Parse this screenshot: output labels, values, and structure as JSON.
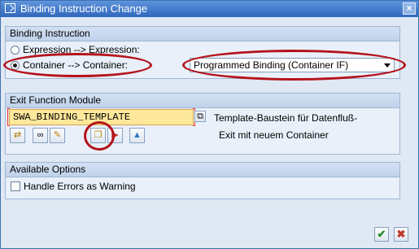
{
  "window": {
    "title": "Binding Instruction Change",
    "close_glyph": "×"
  },
  "binding_instruction": {
    "heading": "Binding Instruction",
    "options": [
      {
        "label": "Expression --> Expression:",
        "selected": false
      },
      {
        "label": "Container --> Container:",
        "selected": true
      }
    ],
    "binding_type": "Programmed Binding (Container IF)"
  },
  "exit_function_module": {
    "heading": "Exit Function Module",
    "value": "SWA_BINDING_TEMPLATE",
    "description_line1": "Template-Baustein für Datenfluß-",
    "description_line2": "Exit mit neuem Container",
    "tools": [
      "change-icon",
      "glasses-icon",
      "pencil-icon",
      "copy-icon",
      "delete-icon",
      "image-icon"
    ]
  },
  "available_options": {
    "heading": "Available Options",
    "checkbox_label": "Handle Errors as Warning",
    "checked": false
  },
  "footer": {
    "ok_glyph": "✔",
    "cancel_glyph": "✖"
  },
  "colors": {
    "annotation": "#b5121b",
    "title_bar": "#2f67bd",
    "input_bg": "#fde89b"
  }
}
